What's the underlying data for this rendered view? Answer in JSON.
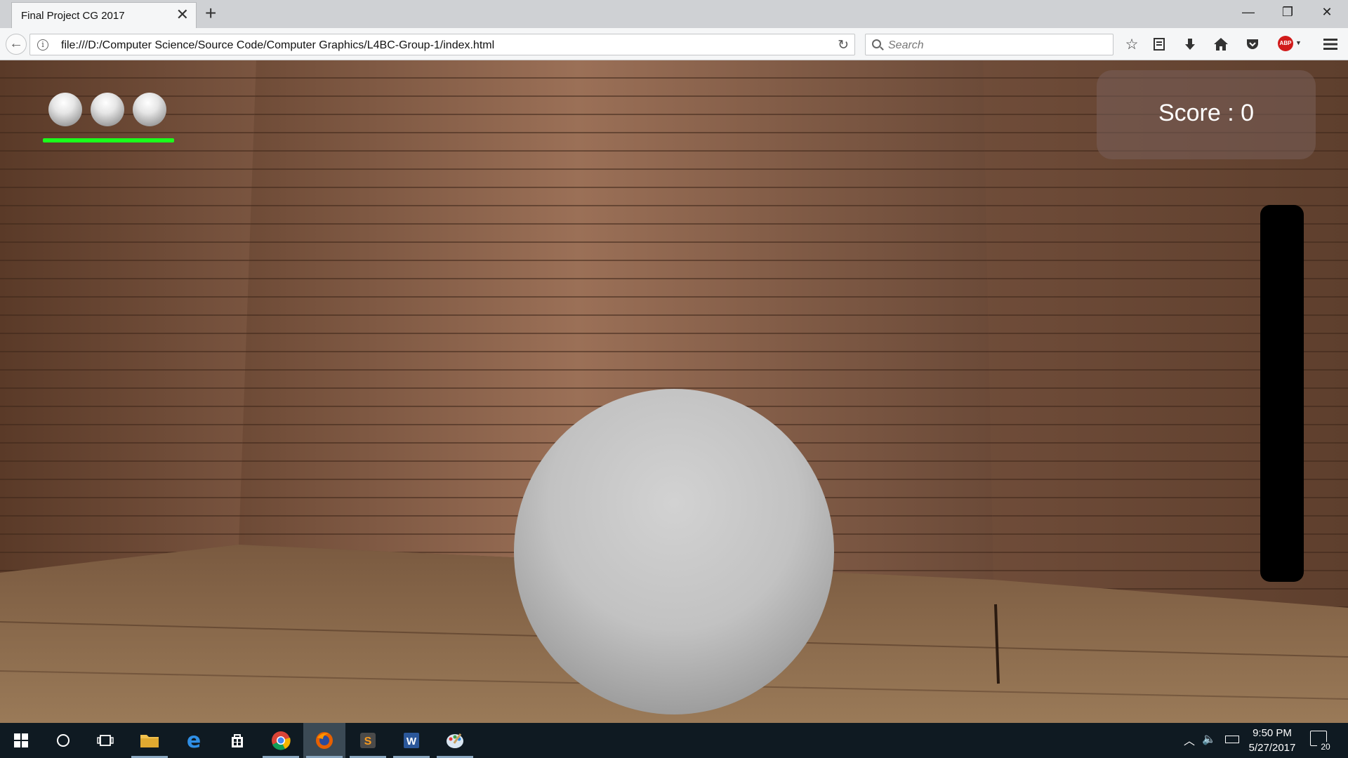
{
  "browser": {
    "tab_title": "Final Project CG 2017",
    "tab_close": "✕",
    "new_tab": "+",
    "url": "file:///D:/Computer Science/Source Code/Computer Graphics/L4BC-Group-1/index.html",
    "search_placeholder": "Search",
    "window_controls": {
      "minimize": "—",
      "restore": "❐",
      "close": "✕"
    },
    "toolbar_icons": [
      "star-icon",
      "reading-list-icon",
      "download-icon",
      "home-icon",
      "pocket-icon",
      "adblock-plus-icon",
      "menu-icon"
    ],
    "adblock_label": "ABP"
  },
  "game": {
    "lives_remaining": 3,
    "health_fraction": 1.0,
    "health_color": "#1bff1b",
    "score_text": "Score : 0",
    "power_fraction": 0.0
  },
  "taskbar": {
    "items": [
      "windows-start-icon",
      "cortana-icon",
      "task-view-icon",
      "file-explorer-icon",
      "edge-icon",
      "store-icon",
      "chrome-icon",
      "firefox-icon",
      "sublime-text-icon",
      "word-icon",
      "paint-icon"
    ],
    "active_item": "firefox-icon",
    "time": "9:50 PM",
    "date": "5/27/2017",
    "notification_count": "20"
  },
  "colors": {
    "accent_taskbar": "#0f1a22",
    "wall_wood": "#7a5540",
    "floor_wood": "#8a6848"
  }
}
